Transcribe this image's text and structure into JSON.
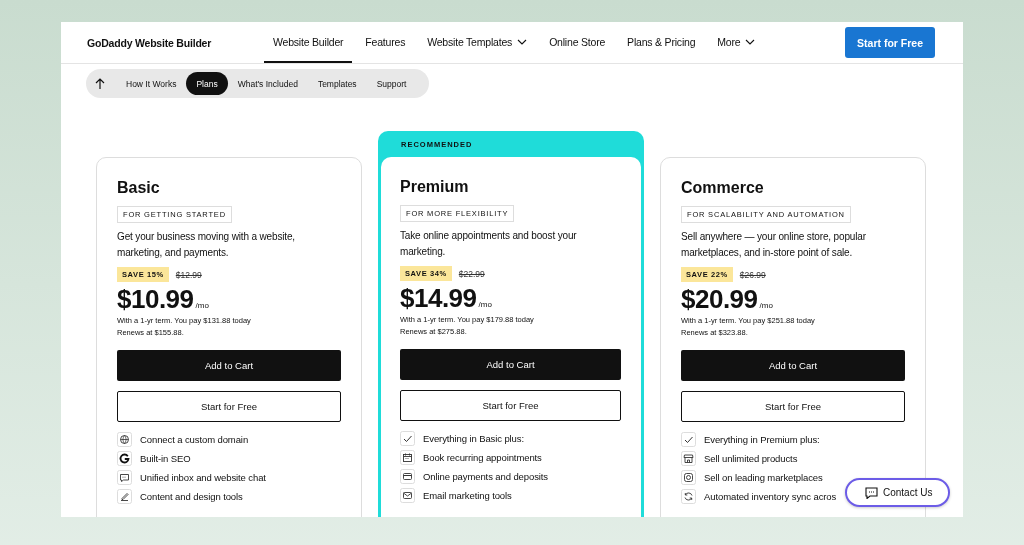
{
  "header": {
    "logo": "GoDaddy Website Builder",
    "nav": [
      {
        "label": "Website Builder",
        "selected": true,
        "dropdown": false
      },
      {
        "label": "Features",
        "selected": false,
        "dropdown": false
      },
      {
        "label": "Website Templates",
        "selected": false,
        "dropdown": true
      },
      {
        "label": "Online Store",
        "selected": false,
        "dropdown": false
      },
      {
        "label": "Plans & Pricing",
        "selected": false,
        "dropdown": false
      },
      {
        "label": "More",
        "selected": false,
        "dropdown": true
      }
    ],
    "cta": "Start for Free"
  },
  "subnav": [
    {
      "label": "How It Works",
      "selected": false
    },
    {
      "label": "Plans",
      "selected": true
    },
    {
      "label": "What's Included",
      "selected": false
    },
    {
      "label": "Templates",
      "selected": false
    },
    {
      "label": "Support",
      "selected": false
    }
  ],
  "plans": [
    {
      "name": "Basic",
      "tag": "FOR GETTING STARTED",
      "description": "Get your business moving with a website, marketing, and payments.",
      "save": "SAVE 15%",
      "old_price": "$12.99",
      "price": "$10.99",
      "per": "/mo",
      "term": "With a 1-yr term. You pay $131.88 today",
      "renews": "Renews at $155.88.",
      "add_button": "Add to Cart",
      "free_button": "Start for Free",
      "features": [
        {
          "kind": "globe",
          "text": "Connect a custom domain"
        },
        {
          "kind": "g",
          "text": "Built-in SEO"
        },
        {
          "kind": "chat",
          "text": "Unified inbox and website chat"
        },
        {
          "kind": "pen",
          "text": "Content and design tools"
        }
      ]
    },
    {
      "name": "Premium",
      "recommended": "RECOMMENDED",
      "tag": "FOR MORE FLEXIBILITY",
      "description": "Take online appointments and boost your marketing.",
      "save": "SAVE 34%",
      "old_price": "$22.99",
      "price": "$14.99",
      "per": "/mo",
      "term": "With a 1-yr term. You pay $179.88 today",
      "renews": "Renews at $275.88.",
      "add_button": "Add to Cart",
      "free_button": "Start for Free",
      "features": [
        {
          "kind": "check",
          "text": "Everything in Basic plus:"
        },
        {
          "kind": "calendar",
          "text": "Book recurring appointments"
        },
        {
          "kind": "card",
          "text": "Online payments and deposits"
        },
        {
          "kind": "mail",
          "text": "Email marketing tools"
        }
      ]
    },
    {
      "name": "Commerce",
      "tag": "FOR SCALABILITY AND AUTOMATION",
      "description": "Sell anywhere — your online store, popular marketplaces, and in-store point of sale.",
      "save": "SAVE 22%",
      "old_price": "$26.99",
      "price": "$20.99",
      "per": "/mo",
      "term": "With a 1-yr term. You pay $251.88 today",
      "renews": "Renews at $323.88.",
      "add_button": "Add to Cart",
      "free_button": "Start for Free",
      "features": [
        {
          "kind": "check",
          "text": "Everything in Premium plus:"
        },
        {
          "kind": "store",
          "text": "Sell unlimited products"
        },
        {
          "kind": "camera",
          "text": "Sell on leading marketplaces"
        },
        {
          "kind": "sync",
          "text": "Automated inventory sync acros"
        }
      ]
    }
  ],
  "contact_button": "Contact Us"
}
